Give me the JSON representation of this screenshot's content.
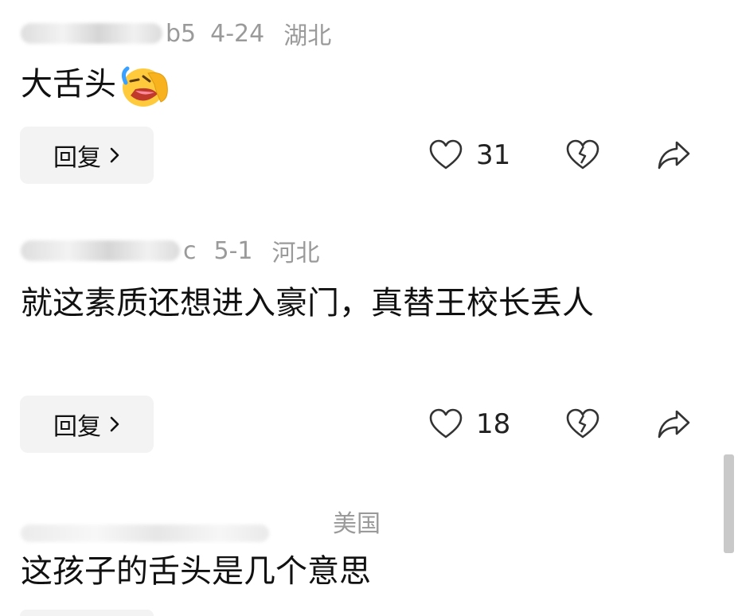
{
  "comments": [
    {
      "user_visible": "b5",
      "date": "4-24",
      "location": "湖北",
      "text": "大舌头",
      "emoji": "rolling-laughing-emoji",
      "reply_label": "回复",
      "likes": "31"
    },
    {
      "user_visible": "c",
      "date": "5-1",
      "location": "河北",
      "text": "就这素质还想进入豪门，真替王校长丢人",
      "reply_label": "回复",
      "likes": "18"
    },
    {
      "user_visible": "",
      "date": "",
      "location": "美国",
      "text": "这孩子的舌头是几个意思"
    }
  ],
  "colors": {
    "meta_text": "#9a9a9a",
    "reply_bg": "#f3f3f3",
    "scrollbar": "#c9c9c9"
  },
  "icons": {
    "like": "heart-outline-icon",
    "dislike": "broken-heart-icon",
    "share": "share-arrow-icon",
    "chevron": "chevron-right-icon"
  }
}
